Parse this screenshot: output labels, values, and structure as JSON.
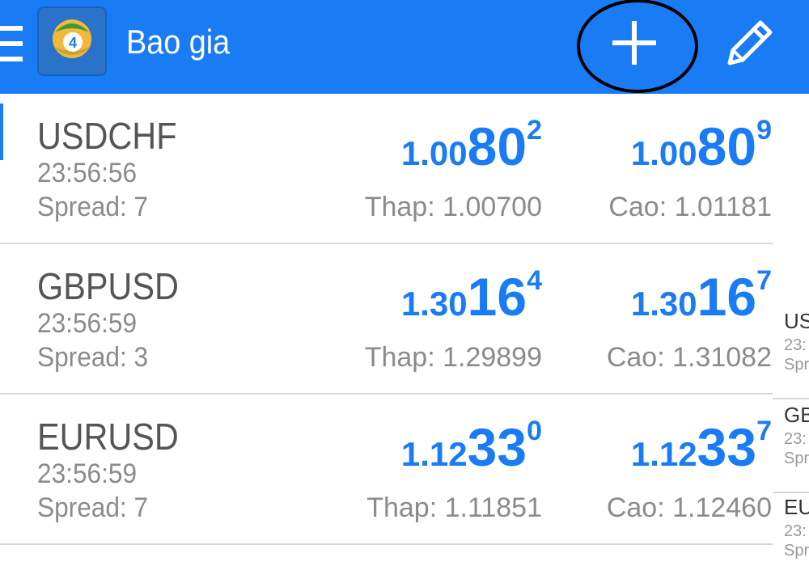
{
  "appbar": {
    "title": "Bao gia",
    "menu_icon": "hamburger-menu-icon",
    "logo_icon": "metatrader4-logo-icon",
    "add_icon": "plus-icon",
    "edit_icon": "pencil-icon",
    "background": "#1a7cf5"
  },
  "quotes": [
    {
      "symbol": "USDCHF",
      "time": "23:56:56",
      "spread": "Spread: 7",
      "bid": {
        "prefix": "1.00",
        "big": "80",
        "sup": "2"
      },
      "ask": {
        "prefix": "1.00",
        "big": "80",
        "sup": "9"
      },
      "low": "Thap: 1.00700",
      "high": "Cao: 1.01181"
    },
    {
      "symbol": "GBPUSD",
      "time": "23:56:59",
      "spread": "Spread: 3",
      "bid": {
        "prefix": "1.30",
        "big": "16",
        "sup": "4"
      },
      "ask": {
        "prefix": "1.30",
        "big": "16",
        "sup": "7"
      },
      "low": "Thap: 1.29899",
      "high": "Cao: 1.31082"
    },
    {
      "symbol": "EURUSD",
      "time": "23:56:59",
      "spread": "Spread: 7",
      "bid": {
        "prefix": "1.12",
        "big": "33",
        "sup": "0"
      },
      "ask": {
        "prefix": "1.12",
        "big": "33",
        "sup": "7"
      },
      "low": "Thap: 1.11851",
      "high": "Cao: 1.12460"
    }
  ],
  "overlay": [
    {
      "symbol": "US",
      "time": "23:",
      "spread": "Spr"
    },
    {
      "symbol": "GB",
      "time": "23:",
      "spread": "Spr"
    },
    {
      "symbol": "EU",
      "time": "23:",
      "spread": "Spr"
    }
  ],
  "colors": {
    "price": "#1a7cf5",
    "secondary_text": "#8b8b8b",
    "symbol_text": "#555555",
    "highlight_circle": "#000000"
  }
}
